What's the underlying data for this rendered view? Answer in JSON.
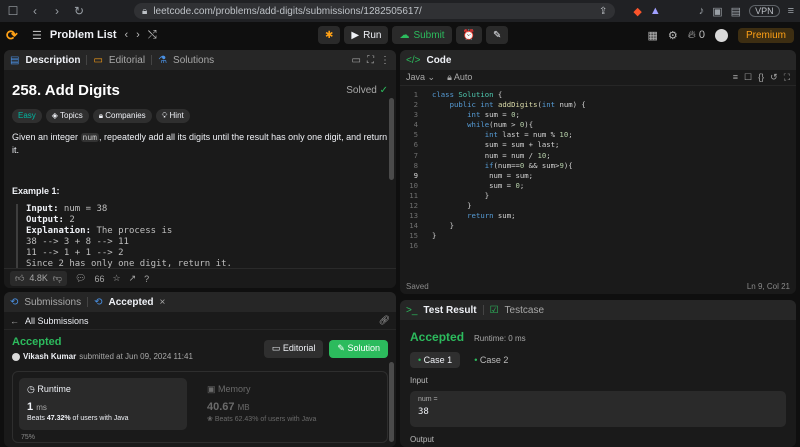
{
  "browser": {
    "url": "leetcode.com/problems/add-digits/submissions/1282505617/",
    "vpn": "VPN"
  },
  "nav": {
    "problem_list": "Problem List",
    "run": "Run",
    "submit": "Submit",
    "streak": "0",
    "premium": "Premium"
  },
  "desc": {
    "tabs": [
      "Description",
      "Editorial",
      "Solutions"
    ],
    "title": "258. Add Digits",
    "solved": "Solved",
    "tags": [
      "Easy",
      "Topics",
      "Companies",
      "Hint"
    ],
    "para_pre": "Given an integer ",
    "para_code": "num",
    "para_post": ", repeatedly add all its digits until the result has only one digit, and return it.",
    "example_title": "Example 1:",
    "ex_input_label": "Input:",
    "ex_input": " num = 38",
    "ex_output_label": "Output:",
    "ex_output": " 2",
    "ex_expl_label": "Explanation:",
    "ex_expl": " The process is",
    "ex_lines": [
      "38 --> 3 + 8 --> 11",
      "11 --> 1 + 1 --> 2",
      "Since 2 has only one digit, return it."
    ],
    "likes": "4.8K",
    "comments": "66"
  },
  "code": {
    "header": "Code",
    "language": "Java",
    "mode": "Auto",
    "status": "Saved",
    "cursor": "Ln 9, Col 21"
  },
  "subs": {
    "tab1": "Submissions",
    "tab2": "Accepted",
    "back": "All Submissions",
    "result": "Accepted",
    "user": "Vikash Kumar",
    "submitted": "submitted at Jun 09, 2024 11:41",
    "editorial": "Editorial",
    "solution": "Solution",
    "runtime_label": "Runtime",
    "runtime_value": "1",
    "runtime_unit": "ms",
    "runtime_beats_pre": "Beats ",
    "runtime_beats": "47.32%",
    "runtime_beats_post": " of users with Java",
    "memory_label": "Memory",
    "memory_value": "40.67",
    "memory_unit": "MB",
    "memory_beats_pre": "Beats ",
    "memory_beats": "62.43%",
    "memory_beats_post": " of users with Java",
    "pct": "75%"
  },
  "test": {
    "tab1": "Test Result",
    "tab2": "Testcase",
    "result": "Accepted",
    "runtime": "Runtime: 0 ms",
    "cases": [
      "Case 1",
      "Case 2"
    ],
    "input_label": "Input",
    "var": "num =",
    "value": "38",
    "output_label": "Output"
  }
}
